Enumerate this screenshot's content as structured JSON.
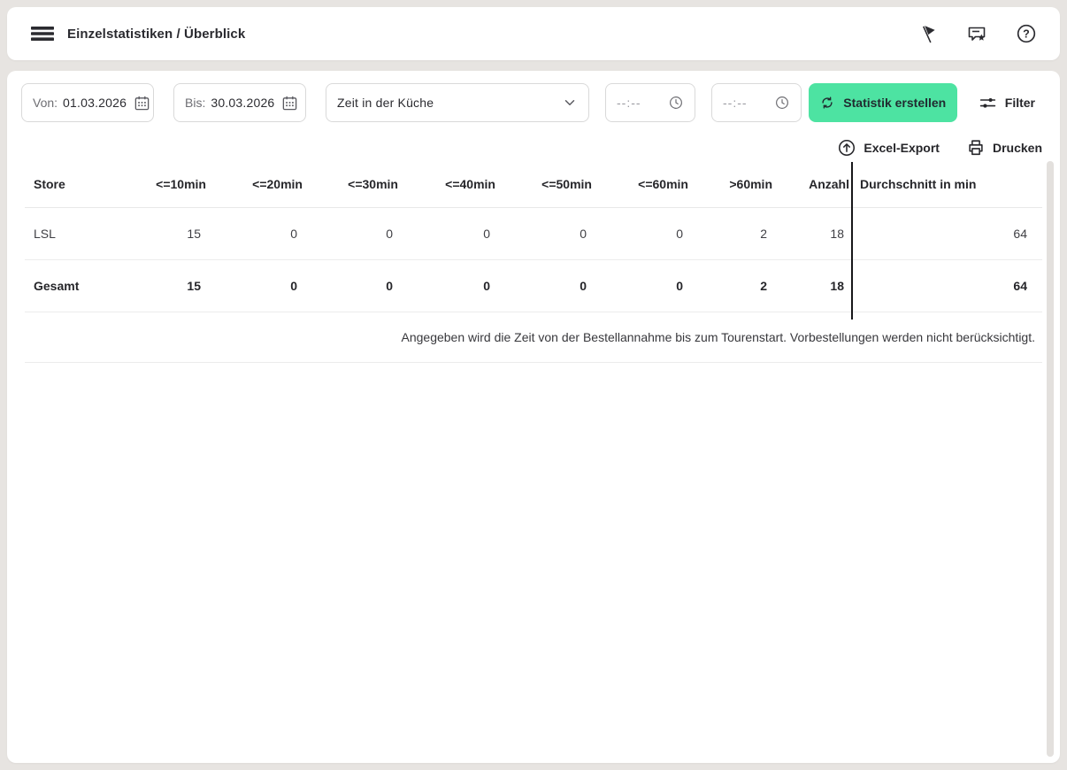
{
  "header": {
    "title": "Einzelstatistiken / Überblick"
  },
  "filters": {
    "from_label": "Von:",
    "from_value": "01.03.2026",
    "to_label": "Bis:",
    "to_value": "30.03.2026",
    "stat_type_selected": "Zeit in der Küche",
    "time_from_placeholder": "--:--",
    "time_to_placeholder": "--:--",
    "create_button_label": "Statistik erstellen",
    "filter_button_label": "Filter"
  },
  "actions": {
    "excel_export_label": "Excel-Export",
    "print_label": "Drucken"
  },
  "table": {
    "columns": [
      "Store",
      "<=10min",
      "<=20min",
      "<=30min",
      "<=40min",
      "<=50min",
      "<=60min",
      ">60min",
      "Anzahl",
      "Durchschnitt in min"
    ],
    "rows": [
      {
        "store": "LSL",
        "v10": "15",
        "v20": "0",
        "v30": "0",
        "v40": "0",
        "v50": "0",
        "v60": "0",
        "gt60": "2",
        "anzahl": "18",
        "avg": "64"
      },
      {
        "store": "Gesamt",
        "v10": "15",
        "v20": "0",
        "v30": "0",
        "v40": "0",
        "v50": "0",
        "v60": "0",
        "gt60": "2",
        "anzahl": "18",
        "avg": "64"
      }
    ],
    "footnote": "Angegeben wird die Zeit von der Bestellannahme bis zum Tourenstart. Vorbestellungen werden nicht berücksichtigt."
  },
  "colors": {
    "accent_green": "#4de3a2",
    "page_background": "#e7e4e1",
    "divider_dark": "#17171a"
  }
}
